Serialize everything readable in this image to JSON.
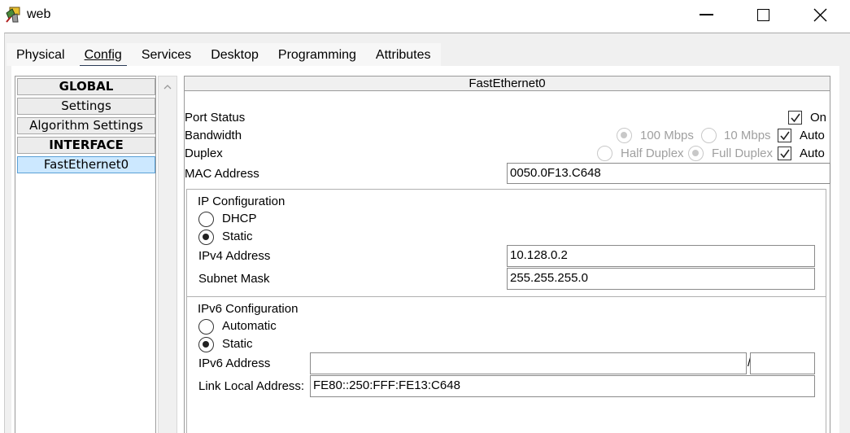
{
  "window": {
    "title": "web"
  },
  "tabs": [
    {
      "label": "Physical"
    },
    {
      "label": "Config"
    },
    {
      "label": "Services"
    },
    {
      "label": "Desktop"
    },
    {
      "label": "Programming"
    },
    {
      "label": "Attributes"
    }
  ],
  "active_tab": "Config",
  "left_panel": {
    "items": [
      {
        "label": "GLOBAL",
        "type": "header"
      },
      {
        "label": "Settings",
        "type": "item"
      },
      {
        "label": "Algorithm Settings",
        "type": "item"
      },
      {
        "label": "INTERFACE",
        "type": "header"
      },
      {
        "label": "FastEthernet0",
        "type": "selected"
      }
    ]
  },
  "interface": {
    "title": "FastEthernet0",
    "port_status": {
      "label": "Port Status",
      "on_label": "On",
      "on_checked": true
    },
    "bandwidth": {
      "label": "Bandwidth",
      "opt1": "100 Mbps",
      "opt2": "10 Mbps",
      "auto_label": "Auto",
      "auto_checked": true,
      "selected": "100 Mbps"
    },
    "duplex": {
      "label": "Duplex",
      "opt1": "Half Duplex",
      "opt2": "Full Duplex",
      "auto_label": "Auto",
      "auto_checked": true,
      "selected": "Full Duplex"
    },
    "mac": {
      "label": "MAC Address",
      "value": "0050.0F13.C648"
    },
    "ip_config": {
      "title": "IP Configuration",
      "dhcp_label": "DHCP",
      "static_label": "Static",
      "selected": "Static",
      "ipv4_label": "IPv4 Address",
      "ipv4_value": "10.128.0.2",
      "subnet_label": "Subnet Mask",
      "subnet_value": "255.255.255.0"
    },
    "ipv6_config": {
      "title": "IPv6 Configuration",
      "auto_label": "Automatic",
      "static_label": "Static",
      "selected": "Static",
      "ipv6_label": "IPv6 Address",
      "ipv6_value": "",
      "prefix_sep": "/",
      "prefix_value": "",
      "link_local_label": "Link Local Address:",
      "link_local_value": "FE80::250:FFF:FE13:C648"
    }
  }
}
